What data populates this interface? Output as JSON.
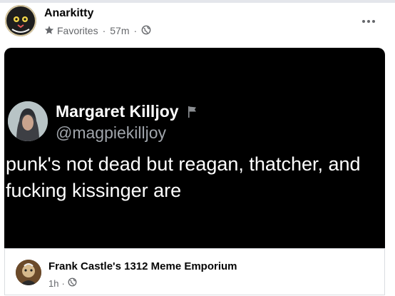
{
  "post": {
    "author": "Anarkitty",
    "audience_label": "Favorites",
    "separator": "·",
    "time": "57m",
    "separator2": "·"
  },
  "embed": {
    "display_name": "Margaret Killjoy",
    "handle": "@magpiekilljoy",
    "text": "punk's not dead but reagan, thatcher, and fucking kissinger are"
  },
  "shared_from": {
    "page_name": "Frank Castle's 1312 Meme Emporium",
    "time": "1h",
    "separator": "·"
  },
  "icons": {
    "audience": "star-icon",
    "privacy": "globe-icon",
    "more": "more-dots-icon",
    "flag": "flag-icon"
  },
  "colors": {
    "embed_background": "#000000",
    "secondary_text": "#65676b",
    "primary_text": "#050505"
  }
}
